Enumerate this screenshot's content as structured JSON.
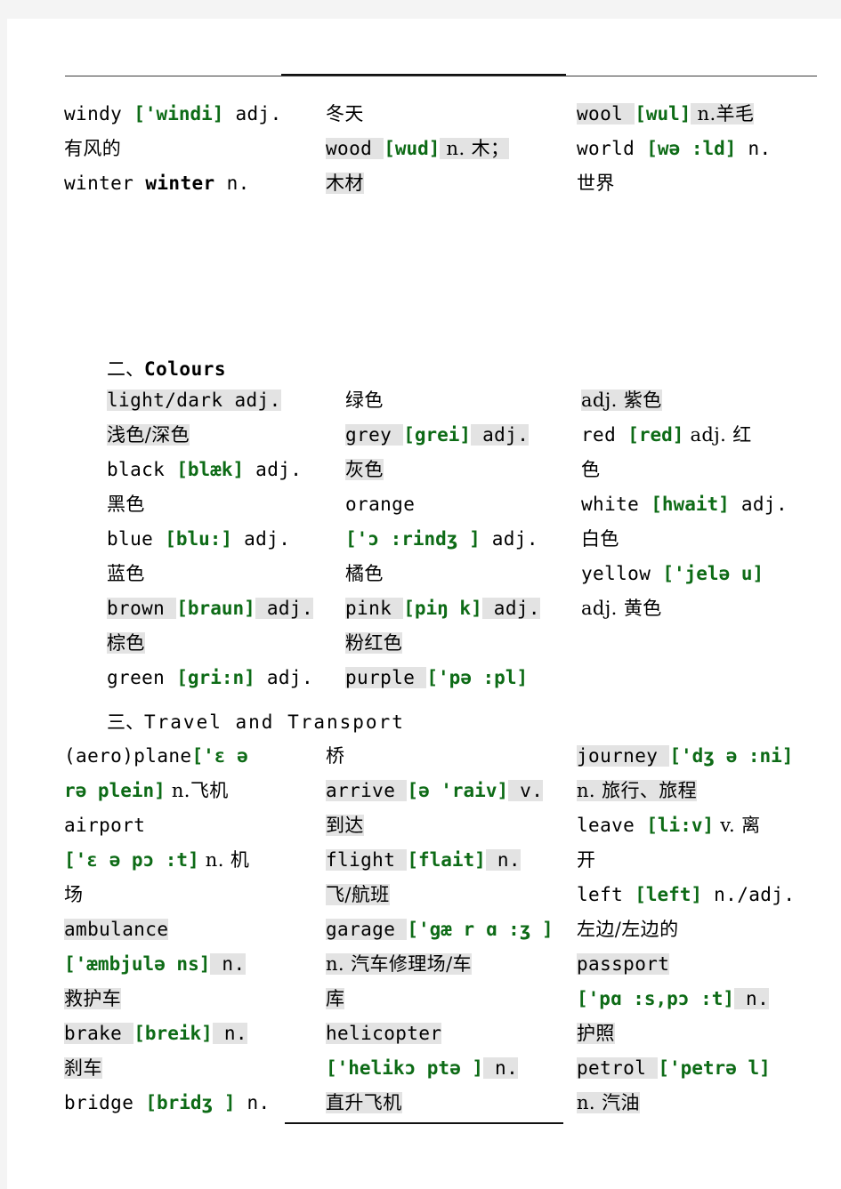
{
  "document": {
    "type": "vocabulary-word-list",
    "highlight_color": "#e3e3e3",
    "ipa_color": "#0d6b16",
    "page_background": "#ffffff"
  },
  "sections": [
    {
      "id": "weather-continued",
      "heading": null,
      "columns": [
        {
          "id": "weather-col-1",
          "lines": [
            {
              "id": "l1",
              "parts": [
                {
                  "t": "windy ",
                  "s": "plain"
                },
                {
                  "t": "['windi]",
                  "s": "ipa"
                },
                {
                  "t": " adj.",
                  "s": "plain"
                }
              ]
            },
            {
              "id": "l2",
              "parts": [
                {
                  "t": "有风的",
                  "s": "zh"
                }
              ]
            },
            {
              "id": "l3",
              "parts": [
                {
                  "t": "winter ",
                  "s": "plain"
                },
                {
                  "t": " winter ",
                  "s": "bold"
                },
                {
                  "t": " n.",
                  "s": "plain"
                }
              ]
            }
          ]
        },
        {
          "id": "weather-col-2",
          "lines": [
            {
              "id": "l1",
              "parts": [
                {
                  "t": "冬天",
                  "s": "zh"
                }
              ]
            },
            {
              "id": "l2",
              "parts": [
                {
                  "t": "wood ",
                  "s": "hl"
                },
                {
                  "t": "[wud]",
                  "s": "ipa"
                },
                {
                  "t": " n. 木；",
                  "s": "hl-zh"
                }
              ]
            },
            {
              "id": "l3",
              "parts": [
                {
                  "t": "木材",
                  "s": "hl-zh"
                }
              ]
            }
          ]
        },
        {
          "id": "weather-col-3",
          "lines": [
            {
              "id": "l1",
              "parts": [
                {
                  "t": "wool ",
                  "s": "hl"
                },
                {
                  "t": " [wul]",
                  "s": "ipa"
                },
                {
                  "t": " n.羊毛",
                  "s": "hl-zh"
                }
              ]
            },
            {
              "id": "l2",
              "parts": [
                {
                  "t": "world ",
                  "s": "plain"
                },
                {
                  "t": "[wə :ld]",
                  "s": "ipa"
                },
                {
                  "t": " n.",
                  "s": "plain"
                }
              ]
            },
            {
              "id": "l3",
              "parts": [
                {
                  "t": "世界",
                  "s": "zh"
                }
              ]
            }
          ]
        }
      ]
    },
    {
      "id": "colours",
      "heading": {
        "number": "二、",
        "title": "Colours",
        "bold": true
      },
      "columns": [
        {
          "id": "colours-col-1",
          "lines": [
            {
              "id": "l1",
              "parts": [
                {
                  "t": "light/dark   adj.",
                  "s": "hl"
                }
              ]
            },
            {
              "id": "l2",
              "parts": [
                {
                  "t": "浅色/深色",
                  "s": "hl-zh"
                }
              ]
            },
            {
              "id": "l3",
              "parts": [
                {
                  "t": "black ",
                  "s": "plain"
                },
                {
                  "t": "[blæk]",
                  "s": "ipa"
                },
                {
                  "t": " adj.",
                  "s": "plain"
                }
              ]
            },
            {
              "id": "l4",
              "parts": [
                {
                  "t": "黑色",
                  "s": "zh"
                }
              ]
            },
            {
              "id": "l5",
              "parts": [
                {
                  "t": "blue ",
                  "s": "plain"
                },
                {
                  "t": "[blu:]",
                  "s": "ipa"
                },
                {
                  "t": " adj.",
                  "s": "plain"
                }
              ]
            },
            {
              "id": "l6",
              "parts": [
                {
                  "t": "蓝色",
                  "s": "zh"
                }
              ]
            },
            {
              "id": "l7",
              "parts": [
                {
                  "t": "brown ",
                  "s": "hl"
                },
                {
                  "t": "[braun]",
                  "s": "ipa"
                },
                {
                  "t": " adj.",
                  "s": "hl"
                }
              ]
            },
            {
              "id": "l8",
              "parts": [
                {
                  "t": "棕色",
                  "s": "hl-zh"
                }
              ]
            },
            {
              "id": "l9",
              "parts": [
                {
                  "t": "green ",
                  "s": "plain"
                },
                {
                  "t": "[gri:n]",
                  "s": "ipa"
                },
                {
                  "t": " adj.",
                  "s": "plain"
                }
              ]
            }
          ]
        },
        {
          "id": "colours-col-2",
          "lines": [
            {
              "id": "l1",
              "parts": [
                {
                  "t": "绿色",
                  "s": "zh"
                }
              ]
            },
            {
              "id": "l2",
              "parts": [
                {
                  "t": "grey ",
                  "s": "hl"
                },
                {
                  "t": " [grei]",
                  "s": "ipa"
                },
                {
                  "t": " adj.",
                  "s": "hl"
                }
              ]
            },
            {
              "id": "l3",
              "parts": [
                {
                  "t": "灰色",
                  "s": "hl-zh"
                }
              ]
            },
            {
              "id": "l4",
              "parts": [
                {
                  "t": "orange",
                  "s": "plain"
                }
              ]
            },
            {
              "id": "l5",
              "parts": [
                {
                  "t": "['ɔ :rindʒ ]",
                  "s": "ipa"
                },
                {
                  "t": " adj.",
                  "s": "plain"
                }
              ]
            },
            {
              "id": "l6",
              "parts": [
                {
                  "t": "橘色",
                  "s": "zh"
                }
              ]
            },
            {
              "id": "l7",
              "parts": [
                {
                  "t": "pink ",
                  "s": "hl"
                },
                {
                  "t": "[piŋ k]",
                  "s": "ipa"
                },
                {
                  "t": " adj.",
                  "s": "hl"
                }
              ]
            },
            {
              "id": "l8",
              "parts": [
                {
                  "t": "粉红色",
                  "s": "hl-zh"
                }
              ]
            },
            {
              "id": "l9",
              "parts": [
                {
                  "t": "purple ",
                  "s": "hl"
                },
                {
                  "t": " ['pə :pl]",
                  "s": "ipa"
                }
              ]
            }
          ]
        },
        {
          "id": "colours-col-3",
          "lines": [
            {
              "id": "l1",
              "parts": [
                {
                  "t": "adj. 紫色",
                  "s": "hl-zh"
                }
              ]
            },
            {
              "id": "l2",
              "parts": [
                {
                  "t": "red ",
                  "s": "plain"
                },
                {
                  "t": "[red]",
                  "s": "ipa"
                },
                {
                  "t": " adj. 红",
                  "s": "plain-zh"
                }
              ]
            },
            {
              "id": "l3",
              "parts": [
                {
                  "t": "色",
                  "s": "zh"
                }
              ]
            },
            {
              "id": "l4",
              "parts": [
                {
                  "t": "white ",
                  "s": "plain"
                },
                {
                  "t": "[hwait]",
                  "s": "ipa"
                },
                {
                  "t": " adj.",
                  "s": "plain"
                }
              ]
            },
            {
              "id": "l5",
              "parts": [
                {
                  "t": "白色",
                  "s": "zh"
                }
              ]
            },
            {
              "id": "l6",
              "parts": [
                {
                  "t": "yellow ",
                  "s": "plain"
                },
                {
                  "t": "['jelə u]",
                  "s": "ipa"
                }
              ]
            },
            {
              "id": "l7",
              "parts": [
                {
                  "t": "adj. 黄色",
                  "s": "plain-zh"
                }
              ]
            }
          ]
        }
      ]
    },
    {
      "id": "travel-and-transport",
      "heading": {
        "number": "三、",
        "title": "Travel and Transport",
        "bold": false
      },
      "columns": [
        {
          "id": "travel-col-1",
          "lines": [
            {
              "id": "l1",
              "parts": [
                {
                  "t": "(aero)plane",
                  "s": "plain"
                },
                {
                  "t": "['ɛ ə",
                  "s": "ipa"
                }
              ]
            },
            {
              "id": "l2",
              "parts": [
                {
                  "t": "rə plein]",
                  "s": "ipa"
                },
                {
                  "t": " n.飞机",
                  "s": "plain-zh"
                }
              ]
            },
            {
              "id": "l3",
              "parts": [
                {
                  "t": "airport",
                  "s": "plain"
                }
              ]
            },
            {
              "id": "l4",
              "parts": [
                {
                  "t": "['ɛ ə pɔ :t]",
                  "s": "ipa"
                },
                {
                  "t": " n. 机",
                  "s": "plain-zh"
                }
              ]
            },
            {
              "id": "l5",
              "parts": [
                {
                  "t": "场",
                  "s": "zh"
                }
              ]
            },
            {
              "id": "l6",
              "parts": [
                {
                  "t": "ambulance",
                  "s": "hl"
                }
              ]
            },
            {
              "id": "l7",
              "parts": [
                {
                  "t": "['æmbjulə ns]",
                  "s": "ipa"
                },
                {
                  "t": "  n.",
                  "s": "hl"
                }
              ]
            },
            {
              "id": "l8",
              "parts": [
                {
                  "t": "救护车",
                  "s": "hl-zh"
                }
              ]
            },
            {
              "id": "l9",
              "parts": [
                {
                  "t": "brake  ",
                  "s": "hl"
                },
                {
                  "t": "[breik]",
                  "s": "ipa"
                },
                {
                  "t": "  n.",
                  "s": "hl"
                }
              ]
            },
            {
              "id": "l10",
              "parts": [
                {
                  "t": "刹车",
                  "s": "hl-zh"
                }
              ]
            },
            {
              "id": "l11",
              "parts": [
                {
                  "t": "bridge ",
                  "s": "plain"
                },
                {
                  "t": "[bridʒ ]",
                  "s": "ipa"
                },
                {
                  "t": " n.",
                  "s": "plain"
                }
              ]
            }
          ]
        },
        {
          "id": "travel-col-2",
          "lines": [
            {
              "id": "l1",
              "parts": [
                {
                  "t": "桥",
                  "s": "zh"
                }
              ]
            },
            {
              "id": "l2",
              "parts": [
                {
                  "t": "arrive ",
                  "s": "hl"
                },
                {
                  "t": "[ə 'raiv]",
                  "s": "ipa"
                },
                {
                  "t": " v.",
                  "s": "hl"
                }
              ]
            },
            {
              "id": "l3",
              "parts": [
                {
                  "t": "到达",
                  "s": "hl-zh"
                }
              ]
            },
            {
              "id": "l4",
              "parts": [
                {
                  "t": "flight ",
                  "s": "hl"
                },
                {
                  "t": " [flait]",
                  "s": "ipa"
                },
                {
                  "t": " n.",
                  "s": "hl"
                }
              ]
            },
            {
              "id": "l5",
              "parts": [
                {
                  "t": "飞/航班",
                  "s": "hl-zh"
                }
              ]
            },
            {
              "id": "l6",
              "parts": [
                {
                  "t": "garage ",
                  "s": "hl"
                },
                {
                  "t": "['gæ r ɑ :ʒ ]",
                  "s": "ipa"
                }
              ]
            },
            {
              "id": "l7",
              "parts": [
                {
                  "t": "n. 汽车修理场/车",
                  "s": "hl-zh"
                }
              ]
            },
            {
              "id": "l8",
              "parts": [
                {
                  "t": "库",
                  "s": "hl-zh"
                }
              ]
            },
            {
              "id": "l9",
              "parts": [
                {
                  "t": "helicopter",
                  "s": "hl"
                }
              ]
            },
            {
              "id": "l10",
              "parts": [
                {
                  "t": "['helikɔ ptə ]",
                  "s": "ipa"
                },
                {
                  "t": "  n.",
                  "s": "hl"
                }
              ]
            },
            {
              "id": "l11",
              "parts": [
                {
                  "t": "直升飞机",
                  "s": "hl-zh"
                }
              ]
            }
          ]
        },
        {
          "id": "travel-col-3",
          "lines": [
            {
              "id": "l1",
              "parts": [
                {
                  "t": "journey ",
                  "s": "hl"
                },
                {
                  "t": "['dʒ ə :ni]",
                  "s": "ipa"
                }
              ]
            },
            {
              "id": "l2",
              "parts": [
                {
                  "t": "n. 旅行、旅程",
                  "s": "hl-zh"
                }
              ]
            },
            {
              "id": "l3",
              "parts": [
                {
                  "t": "leave ",
                  "s": "plain"
                },
                {
                  "t": "[li:v]",
                  "s": "ipa"
                },
                {
                  "t": " v. 离",
                  "s": "plain-zh"
                }
              ]
            },
            {
              "id": "l4",
              "parts": [
                {
                  "t": "开",
                  "s": "zh"
                }
              ]
            },
            {
              "id": "l5",
              "parts": [
                {
                  "t": "left ",
                  "s": "plain"
                },
                {
                  "t": "[left]",
                  "s": "ipa"
                },
                {
                  "t": " n./adj.",
                  "s": "plain"
                }
              ]
            },
            {
              "id": "l6",
              "parts": [
                {
                  "t": "左边/左边的",
                  "s": "zh"
                }
              ]
            },
            {
              "id": "l7",
              "parts": [
                {
                  "t": "passport",
                  "s": "hl"
                }
              ]
            },
            {
              "id": "l8",
              "parts": [
                {
                  "t": "['pɑ :s,pɔ :t]",
                  "s": "ipa"
                },
                {
                  "t": "  n.",
                  "s": "hl"
                }
              ]
            },
            {
              "id": "l9",
              "parts": [
                {
                  "t": "护照",
                  "s": "hl-zh"
                }
              ]
            },
            {
              "id": "l10",
              "parts": [
                {
                  "t": "petrol ",
                  "s": "hl"
                },
                {
                  "t": " ['petrə l]",
                  "s": "ipa"
                }
              ]
            },
            {
              "id": "l11",
              "parts": [
                {
                  "t": "n. 汽油",
                  "s": "hl-zh"
                }
              ]
            }
          ]
        }
      ]
    }
  ]
}
